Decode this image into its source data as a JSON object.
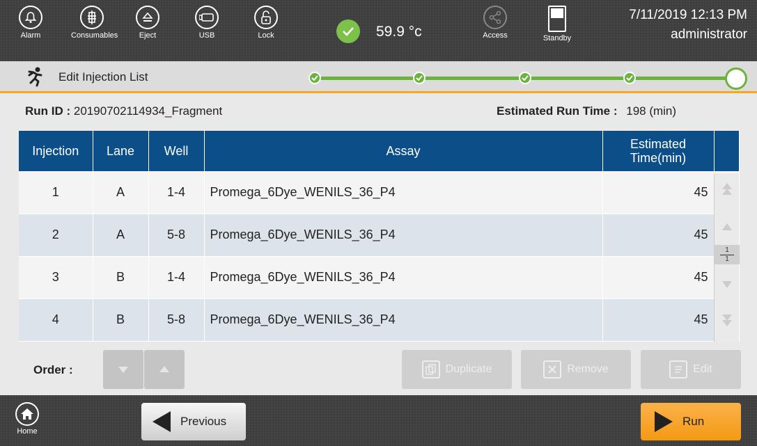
{
  "topbar": {
    "buttons": [
      {
        "label": "Alarm",
        "icon": "bell-icon"
      },
      {
        "label": "Consumables",
        "icon": "consumables-icon"
      },
      {
        "label": "Eject",
        "icon": "eject-icon"
      },
      {
        "label": "USB",
        "icon": "usb-icon"
      },
      {
        "label": "Lock",
        "icon": "lock-icon"
      }
    ],
    "temperature": "59.9 °c",
    "access_label": "Access",
    "standby_label": "Standby",
    "datetime": "7/11/2019 12:13 PM",
    "user": "administrator"
  },
  "subbar": {
    "title": "Edit Injection List",
    "steps_completed": 4,
    "steps_total": 5
  },
  "run_info": {
    "run_id_label": "Run ID :",
    "run_id_value": "20190702114934_Fragment",
    "est_label": "Estimated Run Time :",
    "est_value": "198 (min)"
  },
  "table": {
    "headers": [
      "Injection",
      "Lane",
      "Well",
      "Assay",
      "Estimated",
      "Time(min)"
    ],
    "rows": [
      {
        "injection": "1",
        "lane": "A",
        "well": "1-4",
        "assay": "Promega_6Dye_WENILS_36_P4",
        "time": "45"
      },
      {
        "injection": "2",
        "lane": "A",
        "well": "5-8",
        "assay": "Promega_6Dye_WENILS_36_P4",
        "time": "45"
      },
      {
        "injection": "3",
        "lane": "B",
        "well": "1-4",
        "assay": "Promega_6Dye_WENILS_36_P4",
        "time": "45"
      },
      {
        "injection": "4",
        "lane": "B",
        "well": "5-8",
        "assay": "Promega_6Dye_WENILS_36_P4",
        "time": "45"
      }
    ],
    "page_current": "1",
    "page_total": "1"
  },
  "order_label": "Order :",
  "actions": {
    "duplicate": "Duplicate",
    "remove": "Remove",
    "edit": "Edit"
  },
  "bottombar": {
    "home_label": "Home",
    "previous_label": "Previous",
    "run_label": "Run"
  },
  "colors": {
    "accent": "#f5a623",
    "header_blue": "#0c4e87",
    "step_green": "#6ab43e",
    "run_orange": "#f49a14"
  }
}
